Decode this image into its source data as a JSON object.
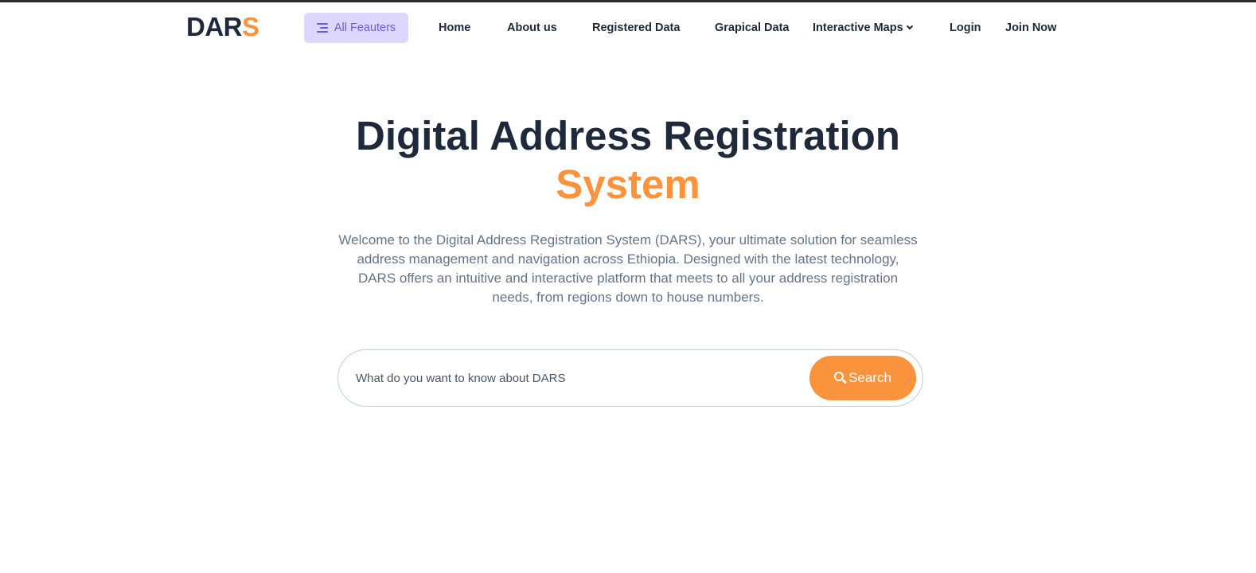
{
  "brand": {
    "logo_main": "DAR",
    "logo_accent": "S"
  },
  "nav": {
    "all_features": "All Feauters",
    "home": "Home",
    "about": "About us",
    "registered": "Registered Data",
    "graphical": "Grapical Data",
    "maps": "Interactive Maps",
    "login": "Login",
    "join": "Join Now"
  },
  "hero": {
    "title_line1": "Digital Address Registration",
    "title_line2": "System",
    "description": "Welcome to the Digital Address Registration System (DARS), your ultimate solution for seamless address management and navigation across Ethiopia. Designed with the latest technology, DARS offers an intuitive and interactive platform that meets to all your address registration needs, from regions down to house numbers."
  },
  "search": {
    "placeholder": "What do you want to know about DARS",
    "button_label": "Search"
  },
  "colors": {
    "accent": "#fb923c",
    "primary_text": "#1e293b",
    "features_bg": "#ddd6fe",
    "features_text": "#6d5bd0"
  },
  "icons": {
    "features": "menu-icon",
    "maps_dropdown": "chevron-down-icon",
    "search": "search-icon"
  }
}
